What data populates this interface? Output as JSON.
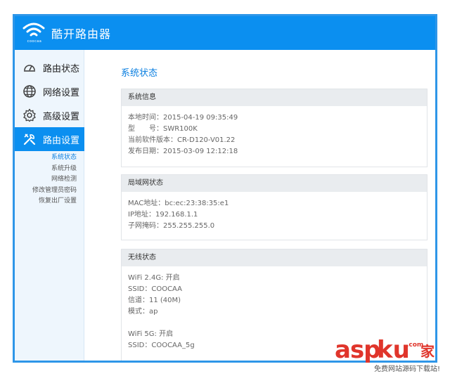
{
  "header": {
    "logo_text": "coocaa",
    "title": "酷开路由器"
  },
  "sidebar": {
    "items": [
      {
        "label": "路由状态",
        "icon": "gauge-icon"
      },
      {
        "label": "网络设置",
        "icon": "globe-icon"
      },
      {
        "label": "高级设置",
        "icon": "gear-icon"
      },
      {
        "label": "路由设置",
        "icon": "tools-icon",
        "active": true
      }
    ],
    "subitems": [
      "系统状态",
      "系统升级",
      "网络检测",
      "修改管理员密码",
      "恢复出厂设置"
    ]
  },
  "main": {
    "page_title": "系统状态",
    "system_info": {
      "title": "系统信息",
      "rows": [
        "本地时间：2015-04-19 09:35:49",
        "型　　号：SWR100K",
        "当前软件版本：CR-D120-V01.22",
        "发布日期：2015-03-09 12:12:18"
      ]
    },
    "lan_status": {
      "title": "局域网状态",
      "rows": [
        "MAC地址：bc:ec:23:38:35:e1",
        "IP地址：192.168.1.1",
        "子网掩码：255.255.255.0"
      ]
    },
    "wireless_status": {
      "title": "无线状态",
      "rows_24g": [
        "WiFi 2.4G: 开启",
        "SSID：COOCAA",
        "信道：11 (40M)",
        "模式：ap"
      ],
      "rows_5g": [
        "WiFi 5G: 开启",
        "SSID：COOCAA_5g"
      ]
    }
  },
  "watermark": {
    "asp": "asp",
    "ku": "ku",
    "com": ".com",
    "jia": "家",
    "sub": "免费网站源码下载站!"
  },
  "colors": {
    "accent": "#0b8ff0",
    "frame": "#2e96e8",
    "watermark": "#e0352b"
  }
}
